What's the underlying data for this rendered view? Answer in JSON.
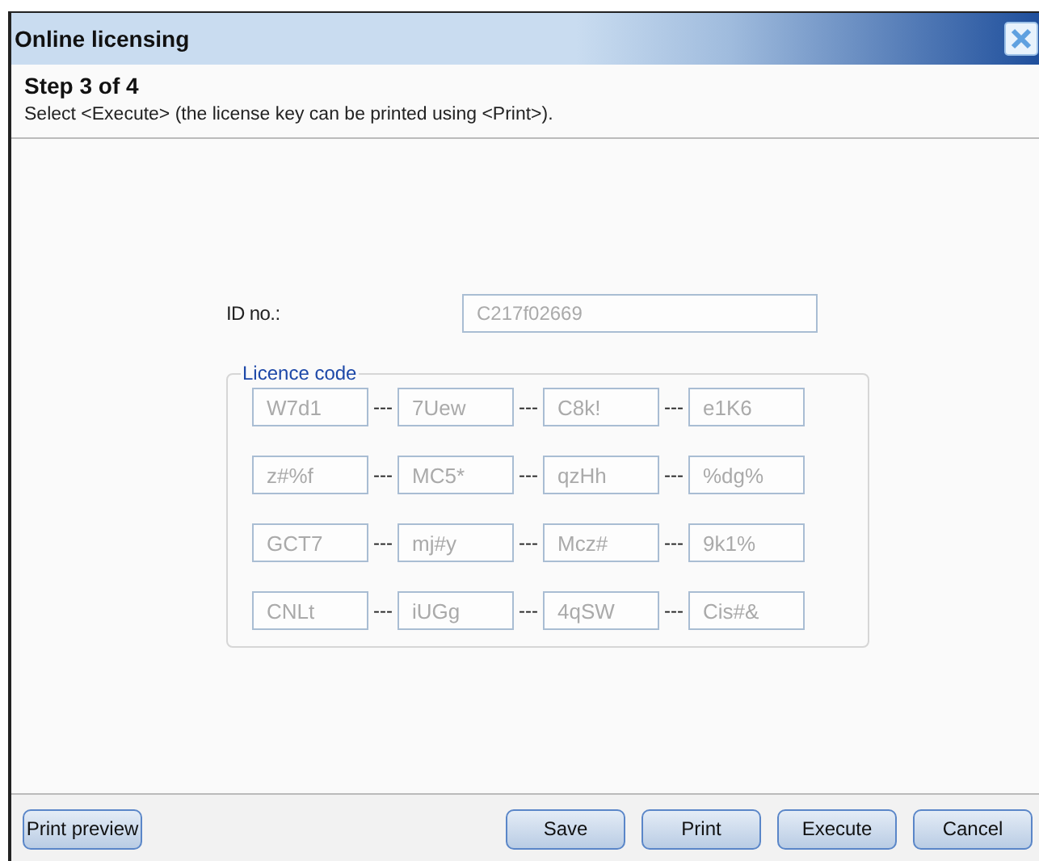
{
  "window": {
    "title": "Online licensing"
  },
  "step": {
    "title": "Step 3 of 4",
    "instruction": "Select <Execute> (the license key can be printed using <Print>)."
  },
  "id_field": {
    "label": "ID no.:",
    "value": "C217f02669",
    "disabled": true
  },
  "licence_code": {
    "legend": "Licence code",
    "separator": "---",
    "disabled": true,
    "rows": [
      [
        "W7d1",
        "7Uew",
        "C8k!",
        "e1K6"
      ],
      [
        "z#%f",
        "MC5*",
        "qzHh",
        "%dg%"
      ],
      [
        "GCT7",
        "mj#y",
        "Mcz#",
        "9k1%"
      ],
      [
        "CNLt",
        "iUGg",
        "4qSW",
        "Cis#&"
      ]
    ]
  },
  "buttons_left": [
    "Print preview"
  ],
  "buttons_right": [
    "Save",
    "Print",
    "Execute",
    "Cancel"
  ]
}
